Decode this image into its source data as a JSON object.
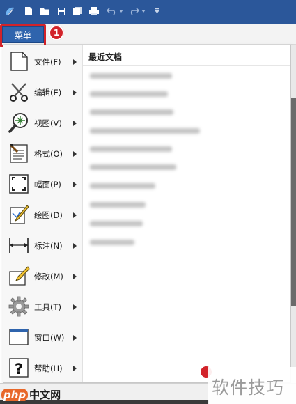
{
  "menu_button": {
    "label": "菜单"
  },
  "step_badge": "1",
  "menu_items": [
    {
      "label": "文件(F)",
      "icon": "new-file-icon"
    },
    {
      "label": "编辑(E)",
      "icon": "scissors-icon"
    },
    {
      "label": "视图(V)",
      "icon": "magnifier-icon"
    },
    {
      "label": "格式(O)",
      "icon": "format-icon"
    },
    {
      "label": "幅面(P)",
      "icon": "page-frame-icon"
    },
    {
      "label": "绘图(D)",
      "icon": "pencil-draw-icon"
    },
    {
      "label": "标注(N)",
      "icon": "dimension-icon"
    },
    {
      "label": "修改(M)",
      "icon": "modify-icon"
    },
    {
      "label": "工具(T)",
      "icon": "gear-icon"
    },
    {
      "label": "窗口(W)",
      "icon": "window-icon"
    },
    {
      "label": "帮助(H)",
      "icon": "help-icon"
    }
  ],
  "recent": {
    "title": "最近文档"
  },
  "watermarks": {
    "php": "php",
    "php_rest": "中文网",
    "site": "软件技巧"
  },
  "colors": {
    "titlebar": "#2b579a",
    "menu_button": "#2f64ad",
    "highlight": "#d2232a"
  }
}
